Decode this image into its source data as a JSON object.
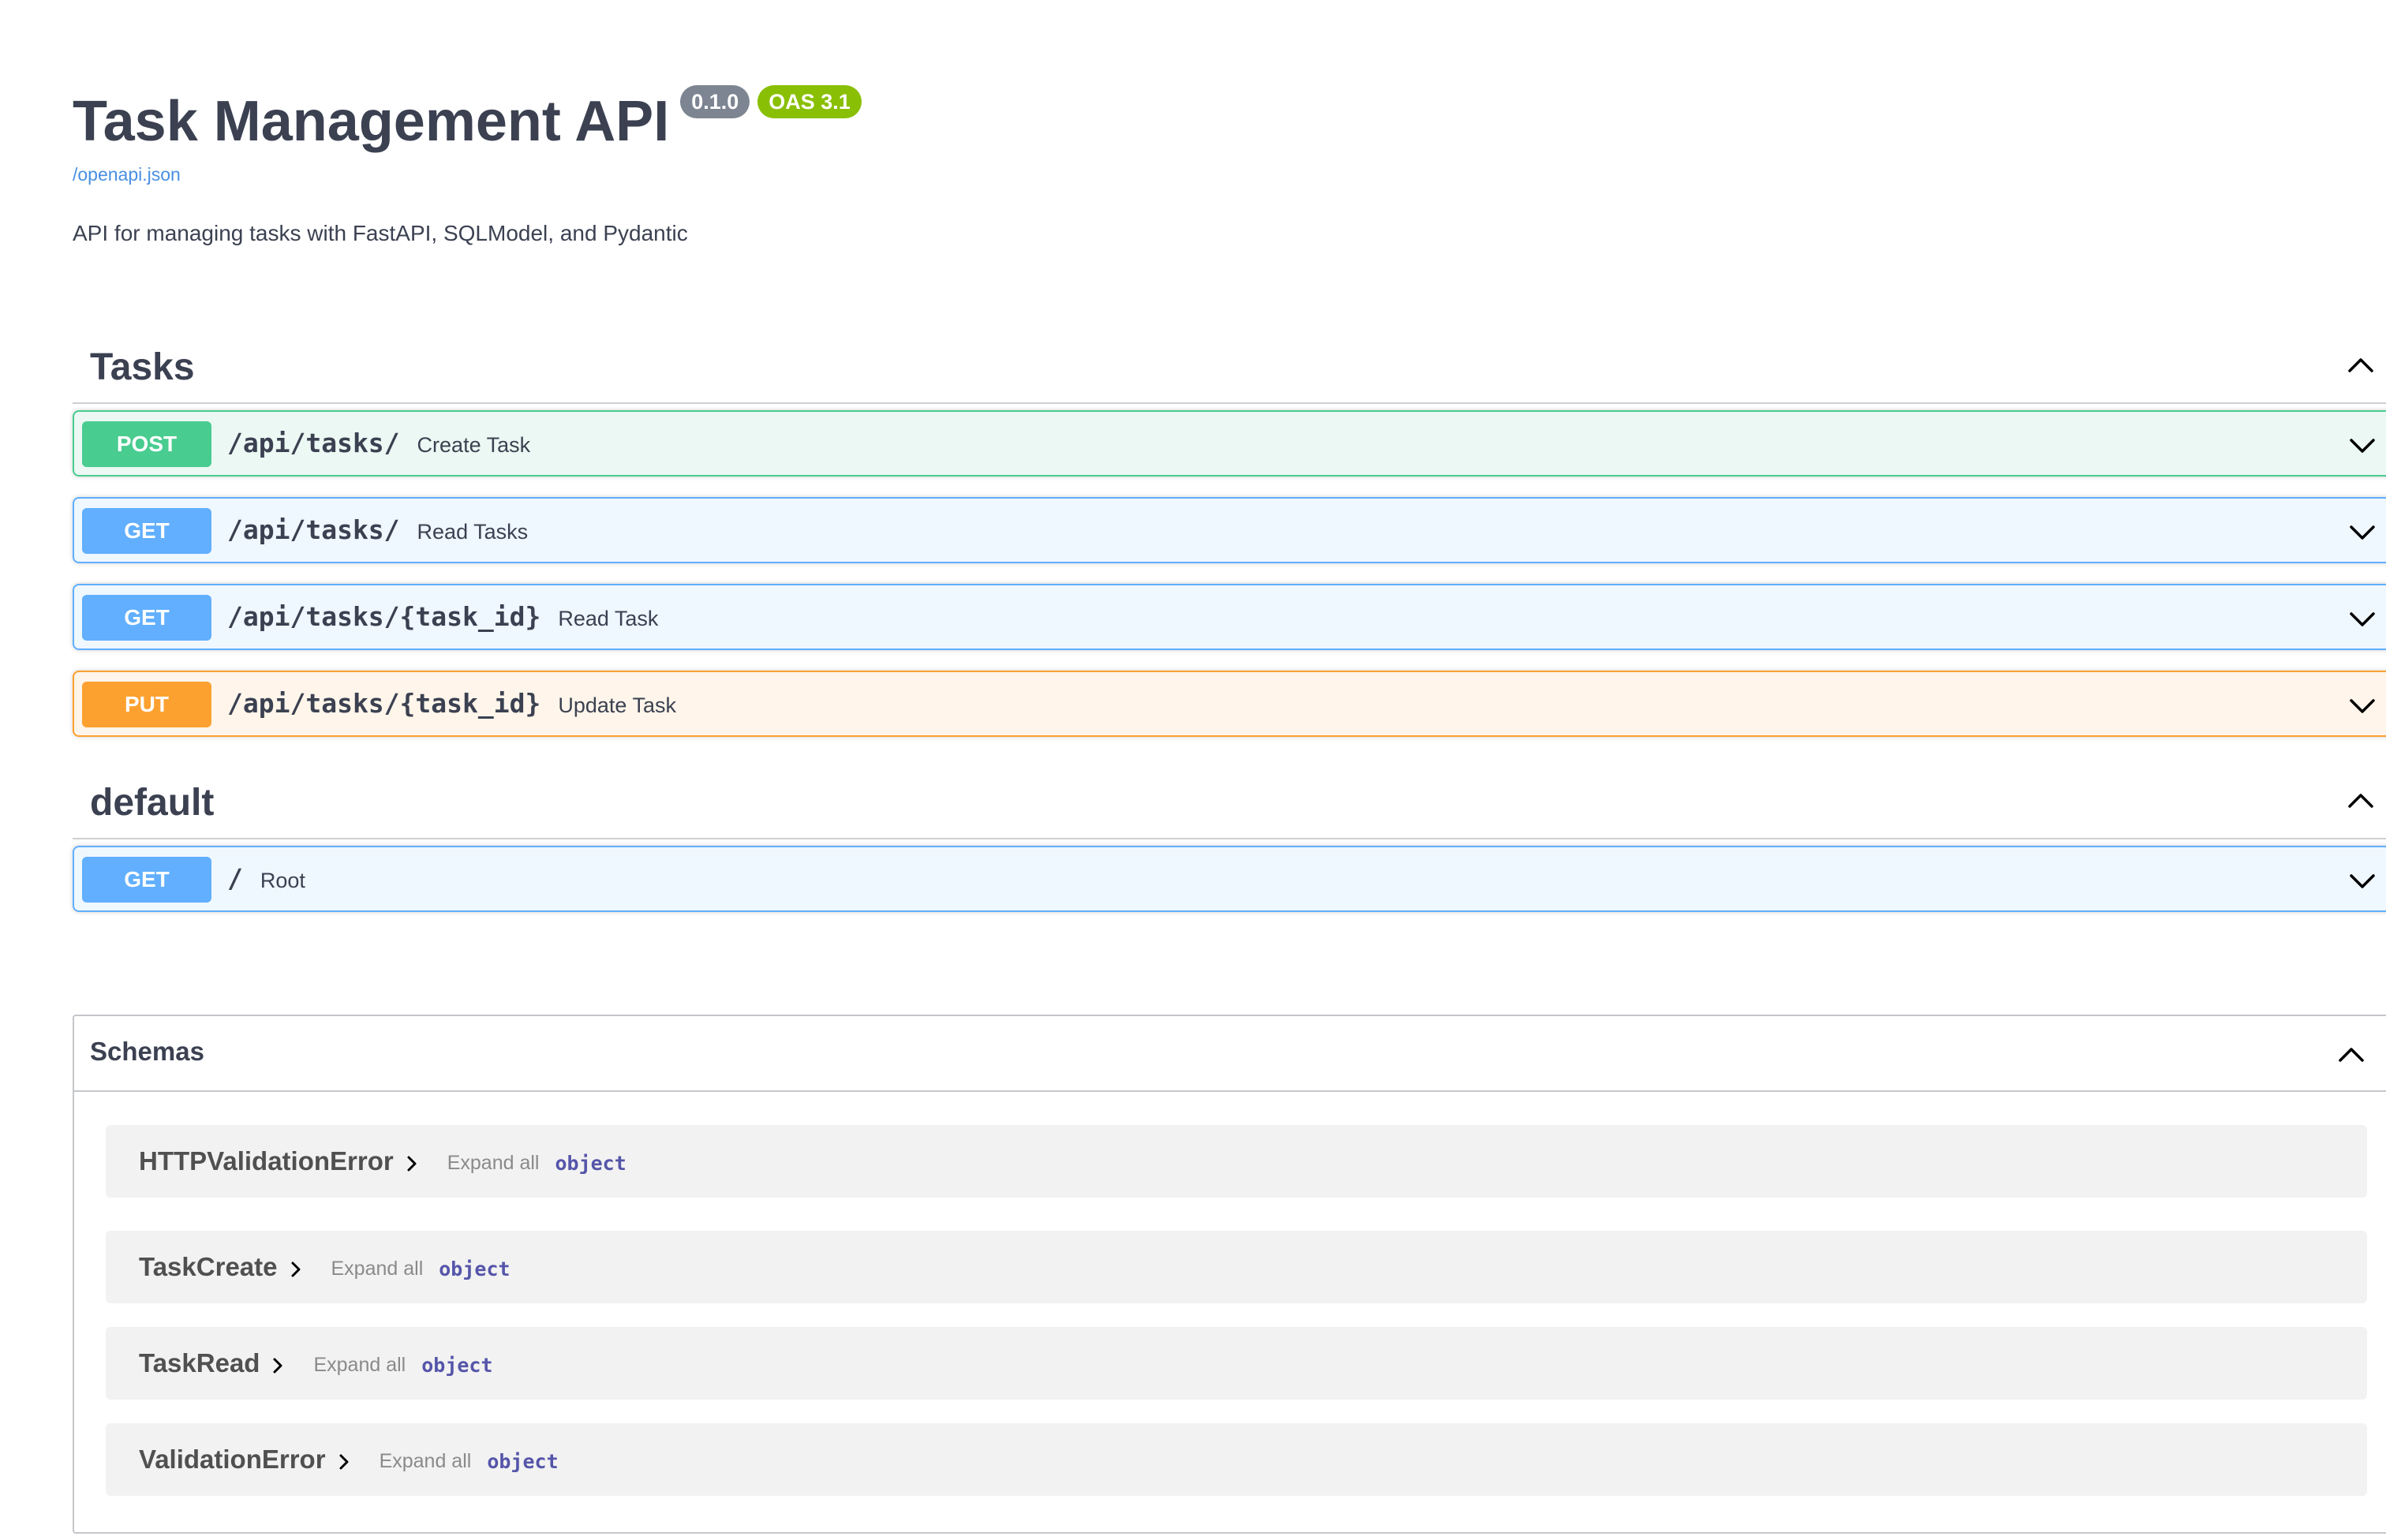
{
  "info": {
    "title": "Task Management API",
    "version": "0.1.0",
    "oas": "OAS 3.1",
    "openapi_link": "/openapi.json",
    "description": "API for managing tasks with FastAPI, SQLModel, and Pydantic"
  },
  "tags": [
    {
      "name": "Tasks",
      "operations": [
        {
          "method": "POST",
          "path": "/api/tasks/",
          "summary": "Create Task"
        },
        {
          "method": "GET",
          "path": "/api/tasks/",
          "summary": "Read Tasks"
        },
        {
          "method": "GET",
          "path": "/api/tasks/{task_id}",
          "summary": "Read Task"
        },
        {
          "method": "PUT",
          "path": "/api/tasks/{task_id}",
          "summary": "Update Task"
        }
      ]
    },
    {
      "name": "default",
      "operations": [
        {
          "method": "GET",
          "path": "/",
          "summary": "Root"
        }
      ]
    }
  ],
  "schemas": {
    "title": "Schemas",
    "models": [
      {
        "name": "HTTPValidationError",
        "expand_label": "Expand all",
        "type": "object"
      },
      {
        "name": "TaskCreate",
        "expand_label": "Expand all",
        "type": "object"
      },
      {
        "name": "TaskRead",
        "expand_label": "Expand all",
        "type": "object"
      },
      {
        "name": "ValidationError",
        "expand_label": "Expand all",
        "type": "object"
      }
    ]
  },
  "icons": {
    "collapse": "chevron-up-icon",
    "expand": "chevron-down-icon",
    "model_expand": "chevron-right-icon"
  },
  "colors": {
    "post": "#49cc90",
    "get": "#61affe",
    "put": "#fca130",
    "link": "#4990e2",
    "version_badge": "#7d8492",
    "oas_badge": "#89bf04"
  }
}
